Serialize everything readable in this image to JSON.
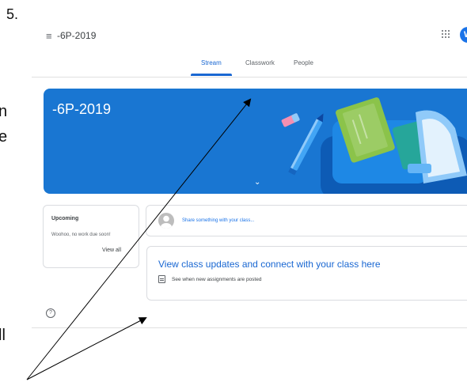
{
  "step_label": "5.",
  "left_fragments": [
    "n",
    "e",
    "ll"
  ],
  "header": {
    "menu_icon": "hamburger-icon",
    "class_name": "-6P-2019",
    "apps_icon": "apps-grid-icon",
    "avatar_letter": "W"
  },
  "tabs": [
    {
      "label": "Stream",
      "active": true
    },
    {
      "label": "Classwork",
      "active": false
    },
    {
      "label": "People",
      "active": false
    }
  ],
  "banner": {
    "title": "-6P-2019",
    "expand_icon": "chevron-down-icon",
    "color": "#1976d2"
  },
  "upcoming": {
    "title": "Upcoming",
    "text": "Woohoo, no work due soon!",
    "link": "View all"
  },
  "share": {
    "placeholder": "Share something with your class..."
  },
  "updates": {
    "title": "View class updates and connect with your class here",
    "item": "See when new assignments are posted"
  },
  "footer": {
    "help_icon": "help-icon"
  },
  "colors": {
    "accent": "#1967d2",
    "banner": "#1976d2"
  }
}
